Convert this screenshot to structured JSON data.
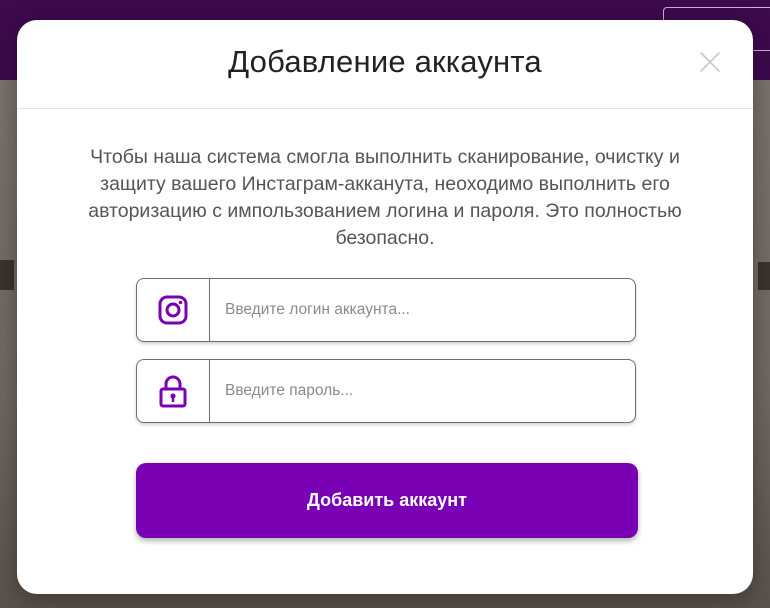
{
  "modal": {
    "title": "Добавление аккаунта",
    "description": "Чтобы наша система смогла выполнить сканирование, очистку и защиту вашего Инстаграм-акканута, неоходимо выполнить его авторизацию с импользованием логина и пароля. Это полностью безопасно.",
    "close_icon": "close-icon"
  },
  "form": {
    "login": {
      "icon": "instagram-icon",
      "value": "",
      "placeholder": "Введите логин аккаунта..."
    },
    "password": {
      "icon": "lock-icon",
      "value": "",
      "placeholder": "Введите пароль..."
    },
    "submit_label": "Добавить аккаунт"
  },
  "colors": {
    "accent": "#7a00b5",
    "header_bar": "#3d0a4d",
    "overlay": "#7d7670"
  }
}
